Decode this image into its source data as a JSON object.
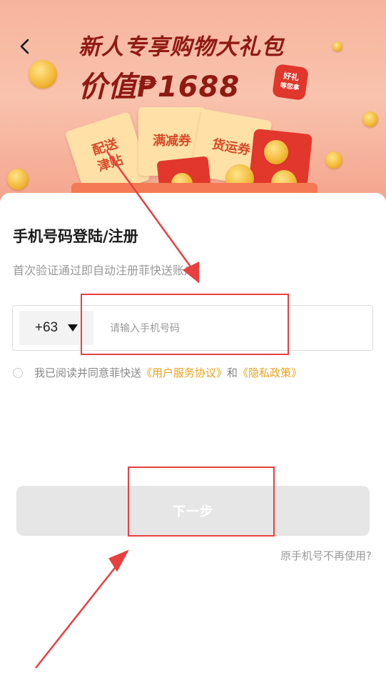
{
  "banner": {
    "headline_line1": "新人专享购物大礼包",
    "headline_line2": "价值₱1688",
    "badge_line1": "好礼",
    "badge_line2": "等您拿",
    "tickets": [
      "配送\n津贴",
      "满减券",
      "货运券"
    ]
  },
  "login": {
    "title": "手机号码登陆/注册",
    "subtitle": "首次验证通过即自动注册菲快送账户",
    "country_code": "+63",
    "phone_placeholder": "请输入手机号码",
    "agreement_prefix": "我已阅读并同意菲快送",
    "user_agreement": "《用户服务协议》",
    "and_text": "和",
    "privacy_policy": "《隐私政策》",
    "next_button": "下一步",
    "old_number_link": "原手机号不再使用?"
  },
  "colors": {
    "accent_red": "#e84040",
    "link_orange": "#e9a21a",
    "button_disabled": "#e6e6e6"
  }
}
